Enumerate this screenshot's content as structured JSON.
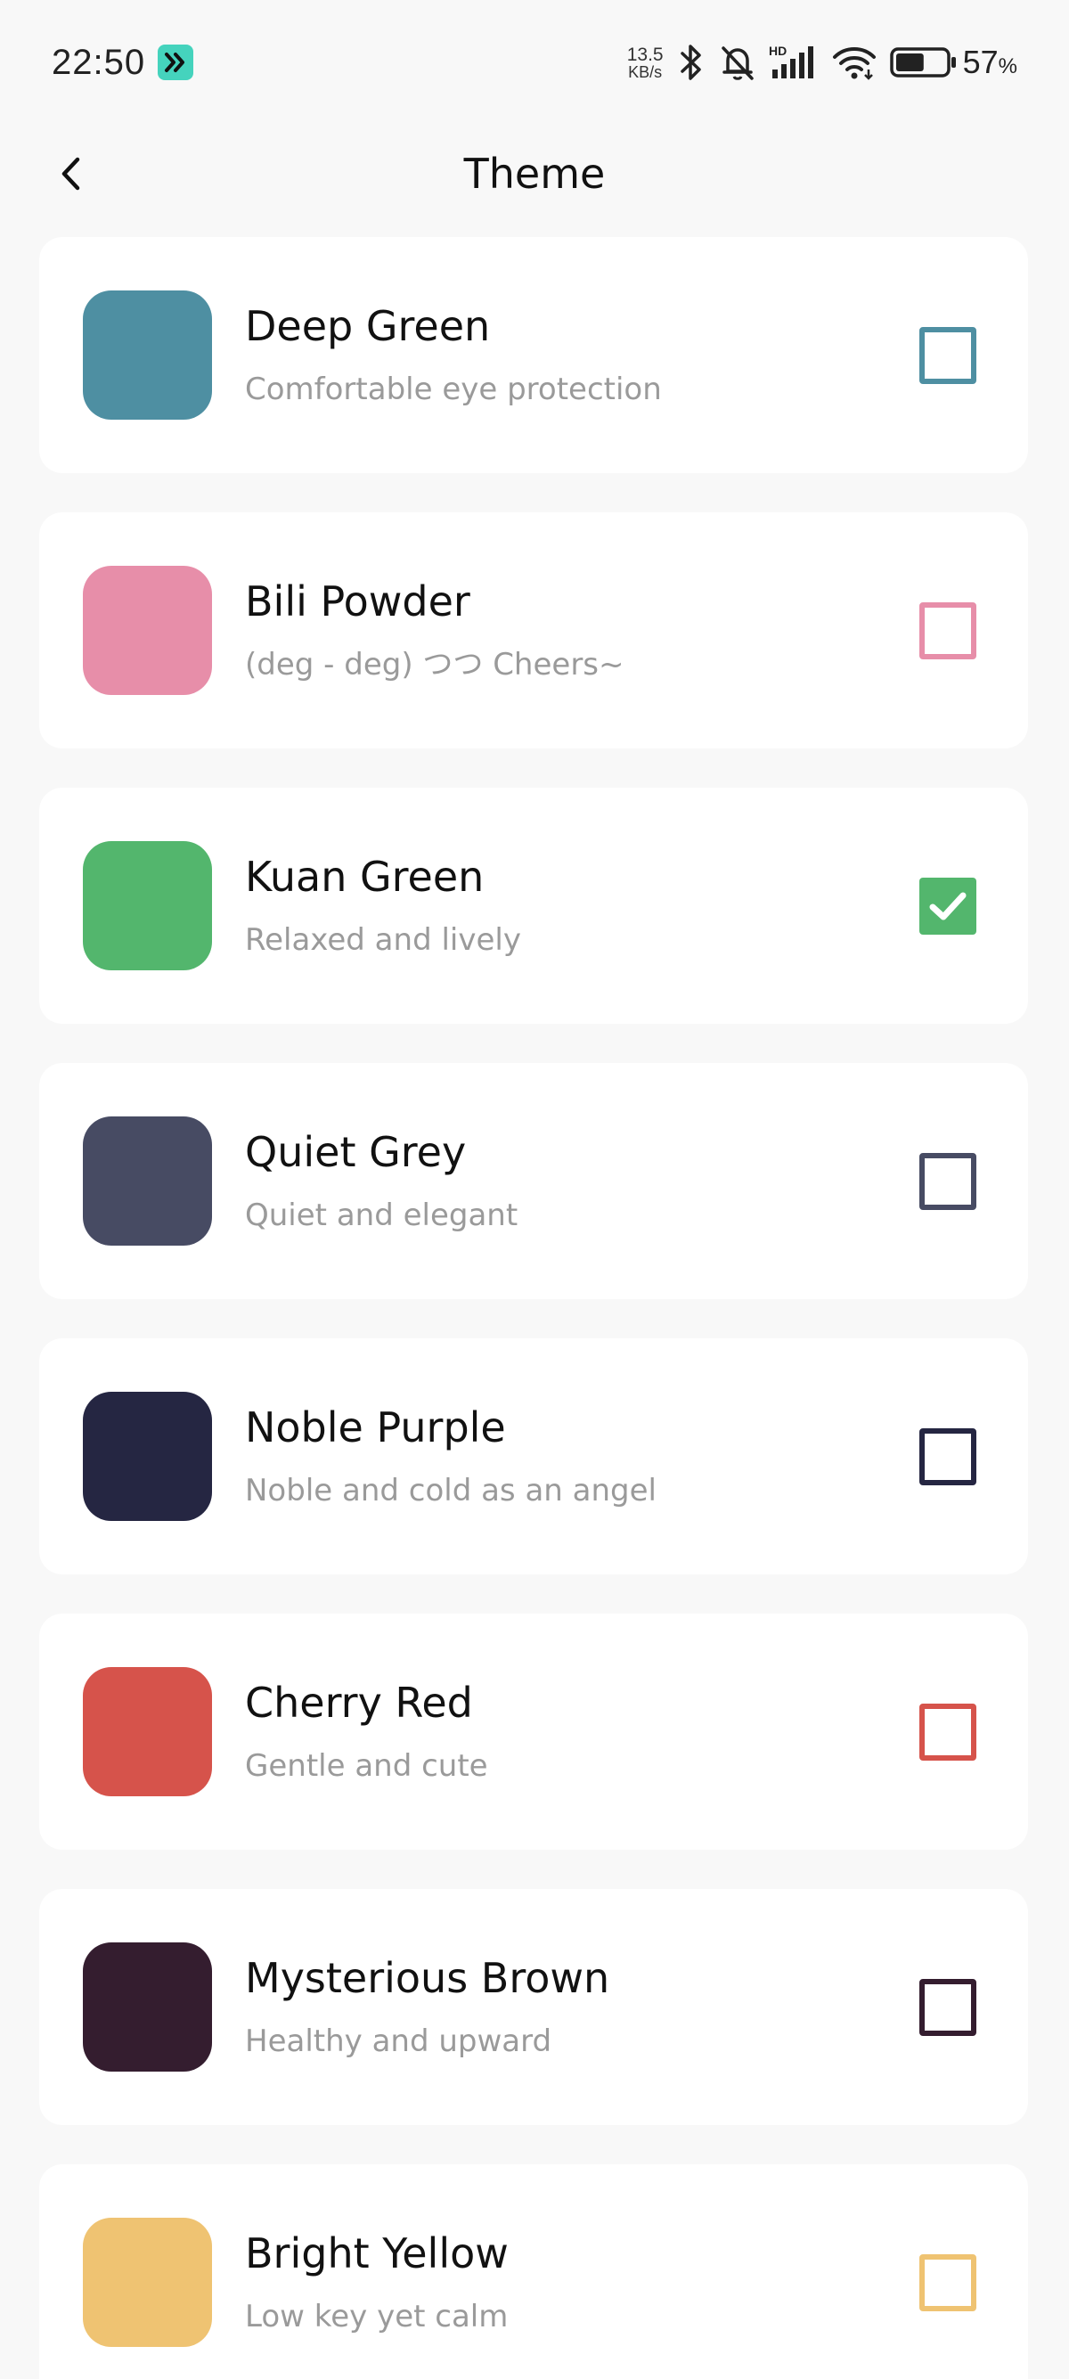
{
  "status_bar": {
    "time": "22:50",
    "net_speed_value": "13.5",
    "net_speed_unit": "KB/s",
    "network_label": "HD",
    "battery_percent": "57",
    "battery_unit": "%",
    "battery_level": 0.57
  },
  "header": {
    "title": "Theme",
    "back_icon": "chevron-left-icon"
  },
  "themes": [
    {
      "name": "Deep Green",
      "description": "Comfortable eye protection",
      "color": "#4e8fa2",
      "checked": false
    },
    {
      "name": "Bili Powder",
      "description": "(deg - deg) つつ Cheers~",
      "color": "#e78ea9",
      "checked": false
    },
    {
      "name": "Kuan Green",
      "description": "Relaxed and lively",
      "color": "#53b66d",
      "checked": true
    },
    {
      "name": "Quiet Grey",
      "description": "Quiet and elegant",
      "color": "#474b63",
      "checked": false
    },
    {
      "name": "Noble Purple",
      "description": "Noble and cold as an angel",
      "color": "#252642",
      "checked": false
    },
    {
      "name": "Cherry Red",
      "description": "Gentle and cute",
      "color": "#d6534b",
      "checked": false
    },
    {
      "name": "Mysterious Brown",
      "description": "Healthy and upward",
      "color": "#341d2f",
      "checked": false
    },
    {
      "name": "Bright Yellow",
      "description": "Low key yet calm",
      "color": "#efc372",
      "checked": false
    }
  ]
}
